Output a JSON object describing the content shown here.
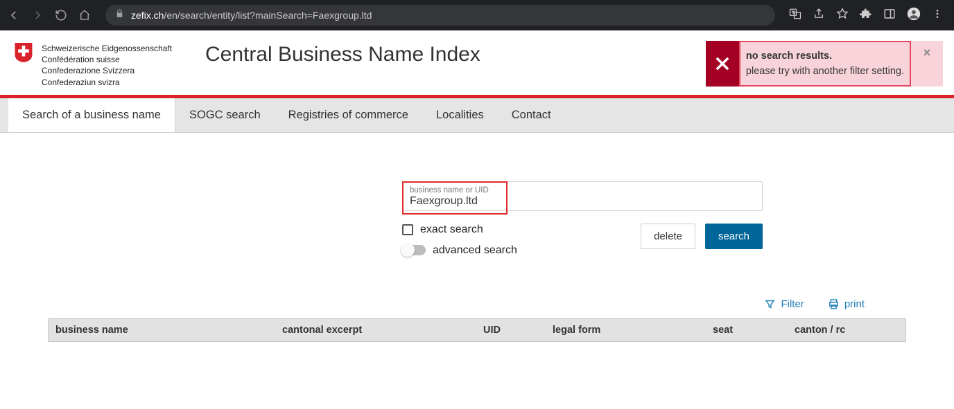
{
  "browser": {
    "url_domain": "zefix.ch",
    "url_path": "/en/search/entity/list?mainSearch=Faexgroup.ltd"
  },
  "confederation": {
    "l1": "Schweizerische Eidgenossenschaft",
    "l2": "Confédération suisse",
    "l3": "Confederazione Svizzera",
    "l4": "Confederaziun svizra"
  },
  "title": "Central Business Name Index",
  "error": {
    "title": "no search results.",
    "body": "please try with another filter setting."
  },
  "tabs": {
    "t1": "Search of a business name",
    "t2": "SOGC search",
    "t3": "Registries of commerce",
    "t4": "Localities",
    "t5": "Contact"
  },
  "search": {
    "field_label": "business name or UID",
    "field_value": "Faexgroup.ltd",
    "exact": "exact search",
    "advanced": "advanced search",
    "delete": "delete",
    "search": "search"
  },
  "actions": {
    "filter": "Filter",
    "print": "print"
  },
  "table": {
    "h1": "business name",
    "h2": "cantonal excerpt",
    "h3": "UID",
    "h4": "legal form",
    "h5": "seat",
    "h6": "canton / rc"
  }
}
